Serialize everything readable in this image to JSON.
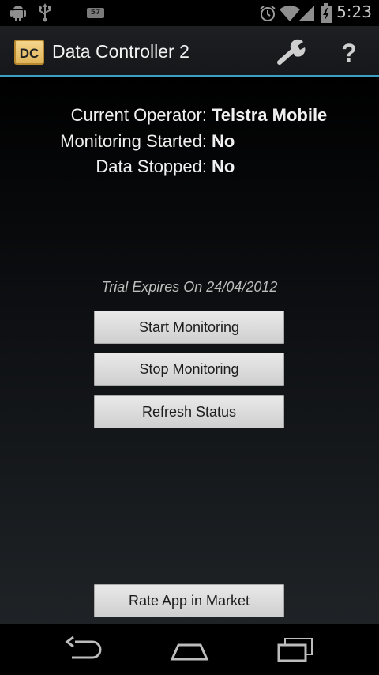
{
  "status_bar": {
    "time": "5:23",
    "badge": "57",
    "icons": [
      "android-debug-icon",
      "usb-icon",
      "alarm-icon",
      "wifi-icon",
      "signal-icon",
      "battery-charging-icon"
    ]
  },
  "action_bar": {
    "app_icon_text": "DC",
    "title": "Data Controller 2",
    "settings_icon": "wrench-icon",
    "help_icon": "?",
    "accent_color": "#3aa0c4"
  },
  "status_info": {
    "operator_label": "Current Operator:",
    "operator_value": "Telstra Mobile",
    "monitoring_label": "Monitoring Started:",
    "monitoring_value": "No",
    "stopped_label": "Data Stopped:",
    "stopped_value": "No"
  },
  "trial_text": "Trial Expires On 24/04/2012",
  "buttons": {
    "start": "Start Monitoring",
    "stop": "Stop Monitoring",
    "refresh": "Refresh Status",
    "rate": "Rate App in Market"
  },
  "nav_bar": {
    "back": "back-icon",
    "home": "home-icon",
    "recents": "recent-apps-icon"
  }
}
